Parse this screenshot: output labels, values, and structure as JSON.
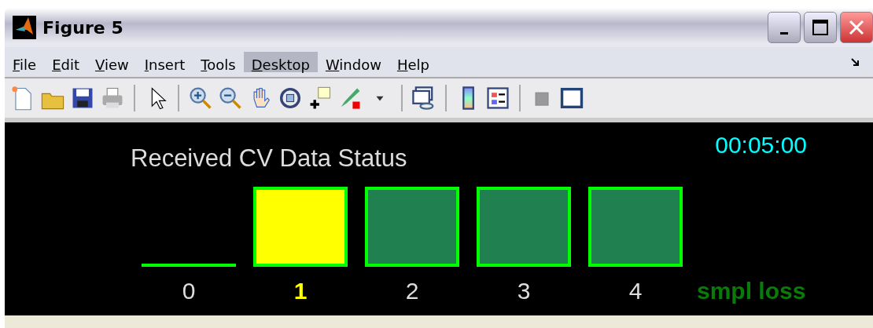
{
  "window": {
    "title": "Figure 5"
  },
  "menu": [
    {
      "label": "File",
      "selected": false
    },
    {
      "label": "Edit",
      "selected": false
    },
    {
      "label": "View",
      "selected": false
    },
    {
      "label": "Insert",
      "selected": false
    },
    {
      "label": "Tools",
      "selected": false
    },
    {
      "label": "Desktop",
      "selected": true
    },
    {
      "label": "Window",
      "selected": false
    },
    {
      "label": "Help",
      "selected": false
    }
  ],
  "figure": {
    "title": "Received CV Data Status",
    "clock": "00:05:00",
    "legend": "smpl loss",
    "tiles": [
      {
        "label": "0",
        "kind": "line",
        "selected": false
      },
      {
        "label": "1",
        "kind": "box",
        "color": "#ffff00",
        "selected": true
      },
      {
        "label": "2",
        "kind": "box",
        "color": "#208050",
        "selected": false
      },
      {
        "label": "3",
        "kind": "box",
        "color": "#208050",
        "selected": false
      },
      {
        "label": "4",
        "kind": "box",
        "color": "#208050",
        "selected": false
      }
    ]
  }
}
